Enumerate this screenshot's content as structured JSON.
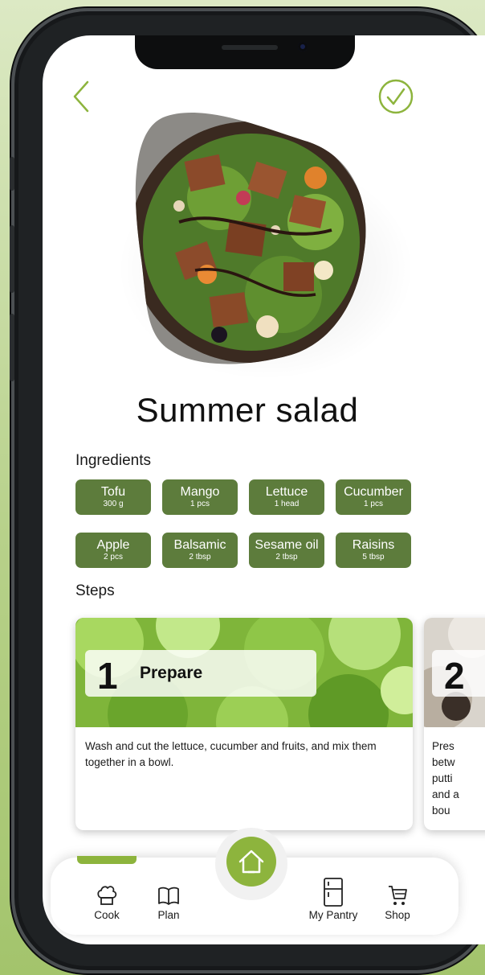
{
  "recipe": {
    "title": "Summer salad",
    "image_icon": "salad-bowl-photo"
  },
  "header": {
    "back_icon": "chevron-left-icon",
    "done_icon": "check-circle-icon",
    "accent": "#8db43d"
  },
  "ingredients": {
    "label": "Ingredients",
    "items": [
      {
        "name": "Tofu",
        "qty": "300 g"
      },
      {
        "name": "Mango",
        "qty": "1 pcs"
      },
      {
        "name": "Lettuce",
        "qty": "1 head"
      },
      {
        "name": "Cucumber",
        "qty": "1 pcs"
      },
      {
        "name": "Apple",
        "qty": "2 pcs"
      },
      {
        "name": "Balsamic",
        "qty": "2 tbsp"
      },
      {
        "name": "Sesame oil",
        "qty": "2 tbsp"
      },
      {
        "name": "Raisins",
        "qty": "5 tbsp"
      }
    ],
    "chip_color": "#5d7c3c"
  },
  "steps": {
    "label": "Steps",
    "items": [
      {
        "number": "1",
        "title": "Prepare",
        "text": "Wash and cut the lettuce, cucumber and fruits, and mix them together in a bowl."
      },
      {
        "number": "2",
        "title": "",
        "text": "Pres betw putti and abou"
      }
    ]
  },
  "nav": {
    "items": [
      {
        "label": "Cook",
        "icon": "chef-hat-icon"
      },
      {
        "label": "Plan",
        "icon": "book-icon"
      },
      {
        "label": "My Pantry",
        "icon": "fridge-icon"
      },
      {
        "label": "Shop",
        "icon": "cart-icon"
      }
    ],
    "home_icon": "home-icon",
    "active": "Cook"
  }
}
